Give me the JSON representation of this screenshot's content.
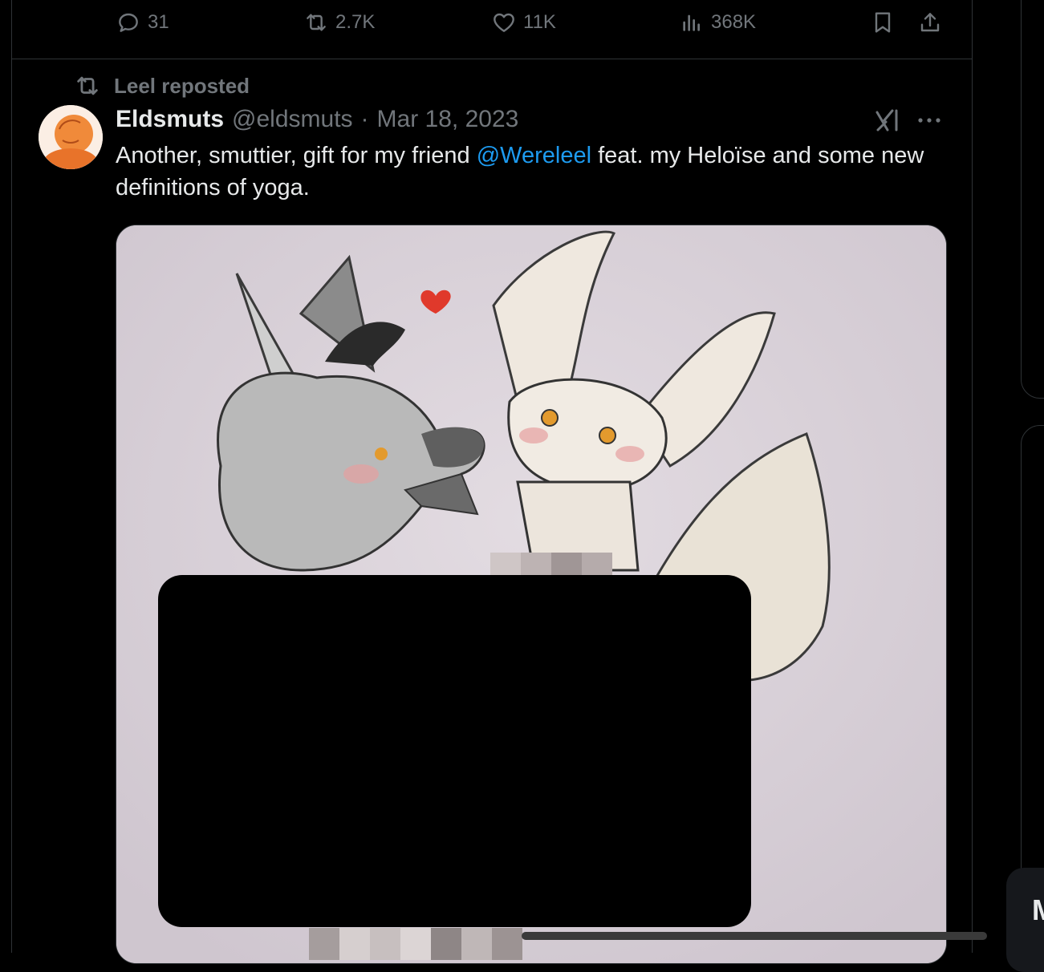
{
  "prev_post_actions": {
    "replies": "31",
    "reposts": "2.7K",
    "likes": "11K",
    "views": "368K"
  },
  "repost_header": {
    "label": "Leel reposted"
  },
  "post": {
    "author_name": "Eldsmuts",
    "handle": "@eldsmuts",
    "separator": "·",
    "date": "Mar 18, 2023",
    "text_part1": "Another, smuttier, gift for my friend ",
    "mention": "@Wereleel",
    "text_part2": " feat. my Heloïse and some new definitions of yoga."
  },
  "side_button": {
    "label": "M"
  },
  "colors": {
    "background": "#000000",
    "text": "#e7e9ea",
    "secondary": "#71767b",
    "link": "#1d9bf0",
    "border": "#2f3336"
  },
  "icons": [
    "reply-icon",
    "repost-icon",
    "like-icon",
    "views-icon",
    "bookmark-icon",
    "share-icon",
    "grok-icon",
    "more-icon"
  ]
}
